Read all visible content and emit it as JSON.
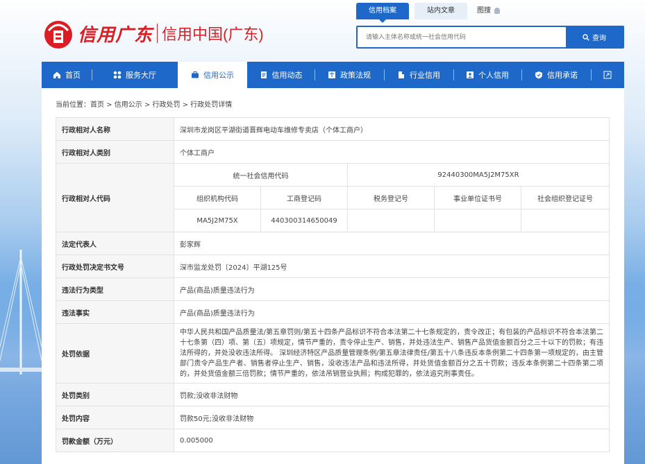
{
  "header": {
    "logo_text": "信用广东",
    "site_name": "信用中国(广东)",
    "top_tabs": [
      "信用档案",
      "站内文章",
      "图搜"
    ],
    "search_placeholder": "请输入主体名称或统一社会信用代码",
    "search_button": "查询"
  },
  "nav": {
    "items": [
      {
        "label": "首页",
        "icon": "home-icon"
      },
      {
        "label": "服务大厅",
        "icon": "grid-icon"
      },
      {
        "label": "信用公示",
        "icon": "briefcase-icon"
      },
      {
        "label": "信用动态",
        "icon": "document-icon"
      },
      {
        "label": "政策法规",
        "icon": "scale-icon"
      },
      {
        "label": "行业信用",
        "icon": "building-icon"
      },
      {
        "label": "个人信用",
        "icon": "user-card-icon"
      },
      {
        "label": "信用承诺",
        "icon": "shield-check-icon"
      }
    ],
    "active_index": 2
  },
  "breadcrumb": {
    "prefix": "当前位置：",
    "items": [
      "首页",
      "信用公示",
      "行政处罚",
      "行政处罚详情"
    ]
  },
  "detail": {
    "name_label": "行政相对人名称",
    "name_value": "深圳市龙岗区平湖街道晋辉电动车维修专卖店（个体工商户）",
    "type_label": "行政相对人类别",
    "type_value": "个体工商户",
    "code_label": "行政相对人代码",
    "uscc_label": "统一社会信用代码",
    "uscc_value": "92440300MA5J2M75XR",
    "org_code_label": "组织机构代码",
    "biz_reg_label": "工商登记码",
    "tax_reg_label": "税务登记号",
    "institution_label": "事业单位证书号",
    "social_org_label": "社会组织登记证号",
    "org_code_value": "MA5J2M75X",
    "biz_reg_value": "440300314650049",
    "tax_reg_value": "",
    "institution_value": "",
    "social_org_value": "",
    "legal_rep_label": "法定代表人",
    "legal_rep_value": "彭家辉",
    "doc_no_label": "行政处罚决定书文号",
    "doc_no_value": "深市监龙处罚〔2024〕平湖125号",
    "violation_type_label": "违法行为类型",
    "violation_type_value": "产品(商品)质量违法行为",
    "facts_label": "违法事实",
    "facts_value": "产品(商品)质量违法行为",
    "basis_label": "处罚依据",
    "basis_value": "中华人民共和国产品质量法/第五章罚则/第五十四条产品标识不符合本法第二十七条规定的，责令改正；有包装的产品标识不符合本法第二十七条第（四）项、第（五）项规定，情节严重的，责令停止生产、销售，并处违法生产、销售产品货值金额百分之三十以下的罚款；有违法所得的，并处没收违法所得。 深圳经济特区产品质量管理条例/第五章法律责任/第五十八条违反本条例第二十四条第一项规定的，由主管部门责令产品生产者、销售者停止生产、销售，没收违法产品和违法所得，并处货值金额百分之五十罚款；违反本条例第二十四条第二项的，并处货值金额三倍罚款；情节严重的，依法吊销营业执照；构成犯罪的，依法追究刑事责任。",
    "category_label": "处罚类别",
    "category_value": "罚款;没收非法财物",
    "content_label": "处罚内容",
    "content_value": "罚款50元;没收非法财物",
    "amount_label": "罚款金额（万元）",
    "amount_value": "0.005000"
  },
  "colors": {
    "brand_blue": "#1e68c9",
    "logo_red": "#d91e26"
  }
}
